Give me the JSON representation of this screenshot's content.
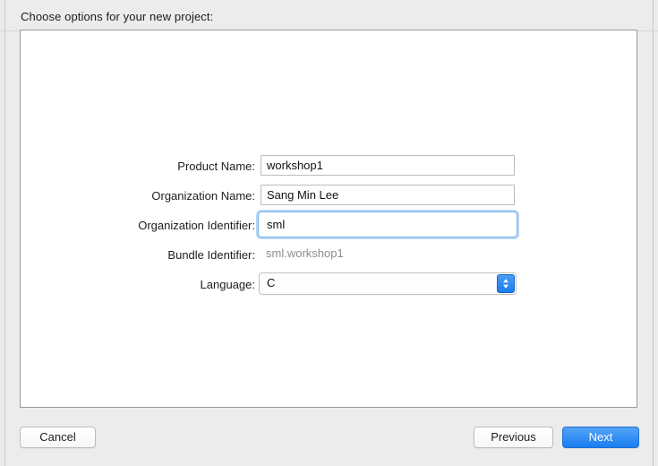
{
  "dialog": {
    "header_title": "Choose options for your new project:"
  },
  "form": {
    "rows": [
      {
        "label": "Product Name:",
        "value": "workshop1",
        "type": "text",
        "focused": false
      },
      {
        "label": "Organization Name:",
        "value": "Sang Min Lee",
        "type": "text",
        "focused": false
      },
      {
        "label": "Organization Identifier:",
        "value": "sml",
        "type": "text",
        "focused": true
      },
      {
        "label": "Bundle Identifier:",
        "value": "sml.workshop1",
        "type": "static",
        "focused": false
      },
      {
        "label": "Language:",
        "value": "C",
        "type": "select",
        "focused": false
      }
    ],
    "language_options": [
      "C"
    ]
  },
  "footer": {
    "cancel_label": "Cancel",
    "previous_label": "Previous",
    "next_label": "Next"
  },
  "colors": {
    "window_background": "#ececec",
    "panel_background": "#ffffff",
    "panel_border": "#9a9a9a",
    "accent_blue": "#1a7ef0",
    "focus_ring": "#7fb3e8",
    "static_text_gray": "#8d8d8d",
    "text": "#1d1d1d"
  }
}
